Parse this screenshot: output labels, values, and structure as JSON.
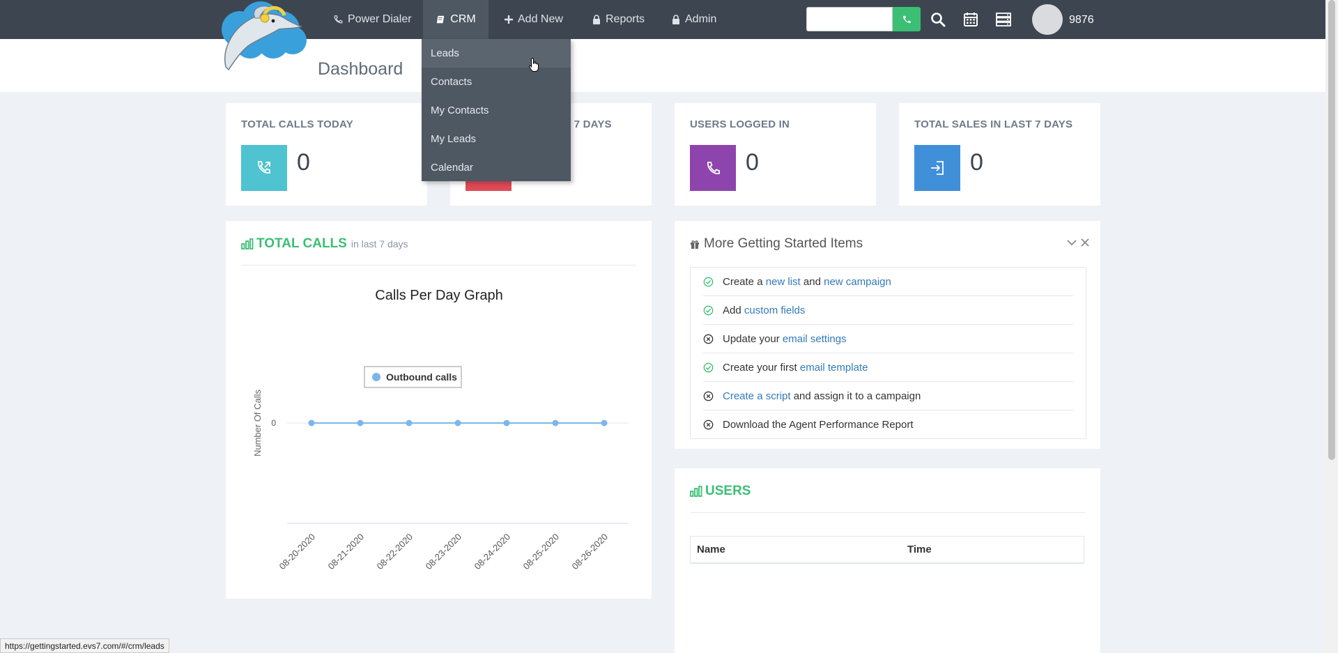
{
  "nav": {
    "items": [
      {
        "label": "Power Dialer",
        "icon": "phone-icon"
      },
      {
        "label": "CRM",
        "icon": "book-icon",
        "active": true
      },
      {
        "label": "Add New",
        "icon": "plus-icon"
      },
      {
        "label": "Reports",
        "icon": "lock-icon"
      },
      {
        "label": "Admin",
        "icon": "lock-icon"
      }
    ],
    "extension": "9876"
  },
  "crm_menu": {
    "items": [
      "Leads",
      "Contacts",
      "My Contacts",
      "My Leads",
      "Calendar"
    ],
    "hovered": "Leads"
  },
  "page": {
    "title": "Dashboard"
  },
  "stats": [
    {
      "title": "TOTAL CALLS TODAY",
      "value": "0",
      "color": "#4fc3cf"
    },
    {
      "title": "T 7 DAYS",
      "value": "",
      "color": "#e04b57"
    },
    {
      "title": "USERS LOGGED IN",
      "value": "0",
      "color": "#8e44ad"
    },
    {
      "title": "TOTAL SALES IN LAST 7 DAYS",
      "value": "0",
      "color": "#3f8fd9"
    }
  ],
  "total_calls_panel": {
    "title": "TOTAL CALLS",
    "subtitle": "in last 7 days"
  },
  "chart_data": {
    "type": "line",
    "title": "Calls Per Day Graph",
    "ylabel": "Number Of Calls",
    "xlabel": "",
    "x": [
      "08-20-2020",
      "08-21-2020",
      "08-22-2020",
      "08-23-2020",
      "08-24-2020",
      "08-25-2020",
      "08-26-2020"
    ],
    "series": [
      {
        "name": "Outbound calls",
        "values": [
          0,
          0,
          0,
          0,
          0,
          0,
          0
        ],
        "color": "#7cb5ec"
      }
    ],
    "yticks": [
      "0"
    ],
    "legend": "top-center",
    "grid": true
  },
  "getting_started": {
    "title": "More Getting Started Items",
    "items": [
      {
        "done": true,
        "parts": [
          {
            "t": "Create a "
          },
          {
            "t": "new list",
            "link": true
          },
          {
            "t": " and "
          },
          {
            "t": "new campaign",
            "link": true
          }
        ]
      },
      {
        "done": true,
        "parts": [
          {
            "t": "Add "
          },
          {
            "t": "custom fields",
            "link": true
          }
        ]
      },
      {
        "done": false,
        "parts": [
          {
            "t": "Update your "
          },
          {
            "t": "email settings",
            "link": true
          }
        ]
      },
      {
        "done": true,
        "parts": [
          {
            "t": "Create your first "
          },
          {
            "t": "email template",
            "link": true
          }
        ]
      },
      {
        "done": false,
        "parts": [
          {
            "t": "Create a script",
            "link": true
          },
          {
            "t": " and assign it to a campaign"
          }
        ]
      },
      {
        "done": false,
        "parts": [
          {
            "t": "Download the Agent Performance Report"
          }
        ]
      }
    ]
  },
  "users_panel": {
    "title": "USERS",
    "columns": [
      "Name",
      "Time"
    ]
  },
  "status_url": "https://gettingstarted.evs7.com/#/crm/leads"
}
